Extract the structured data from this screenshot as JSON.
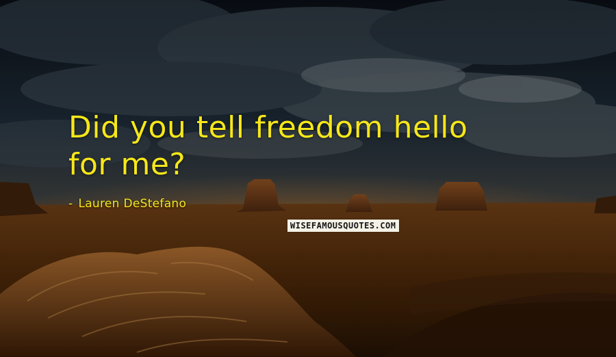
{
  "quote": {
    "line1": "Did you tell freedom hello",
    "line2": "for me?"
  },
  "author": {
    "dash": "-",
    "name": "Lauren DeStefano"
  },
  "watermark": {
    "text": "WISEFAMOUSQUOTES.COM"
  },
  "colors": {
    "quote_text": "#f6e71a",
    "sky_top": "#0c1118",
    "sky_mid": "#2a3a48",
    "desert": "#6a3a12",
    "rock_highlight": "#b87a3a"
  },
  "background": {
    "scene": "desert-buttes-under-cloudy-sky"
  }
}
